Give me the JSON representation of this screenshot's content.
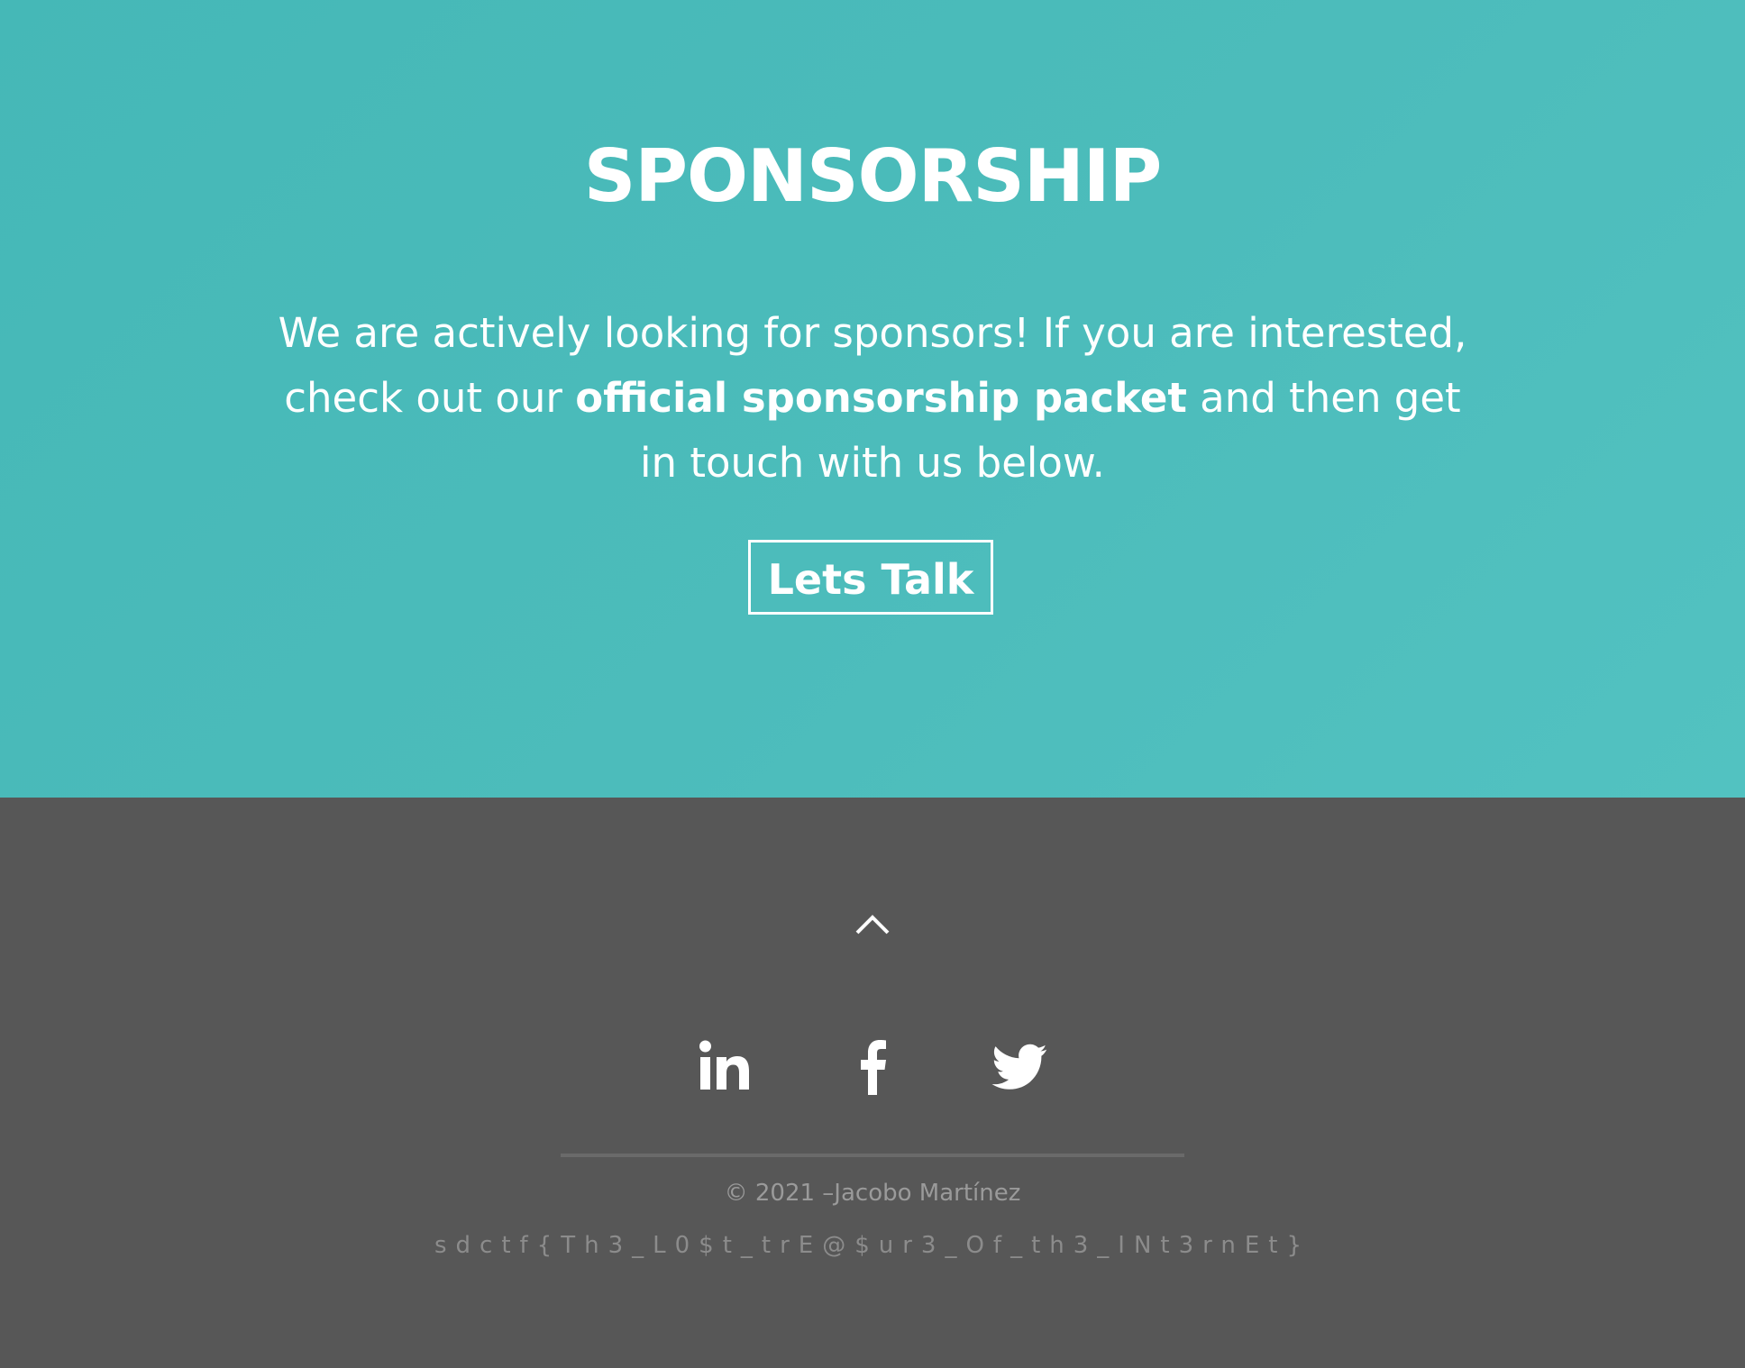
{
  "sponsorship": {
    "title": "SPONSORSHIP",
    "text_before": "We are actively looking for sponsors! If you are interested, check out our ",
    "link_text": "official sponsorship packet",
    "text_after": " and then get in touch with us below.",
    "cta_label": "Lets Talk",
    "bg_color": "#4bbcbb"
  },
  "footer": {
    "up_icon": "chevron-up-icon",
    "social": [
      {
        "name": "linkedin-icon"
      },
      {
        "name": "facebook-icon"
      },
      {
        "name": "twitter-icon"
      }
    ],
    "copyright": "© 2021 –Jacobo Martínez",
    "flag": "sdctf{Th3_L0$t_trE@$ur3_Of_th3_INt3rnEt}",
    "bg_color": "#575757"
  }
}
